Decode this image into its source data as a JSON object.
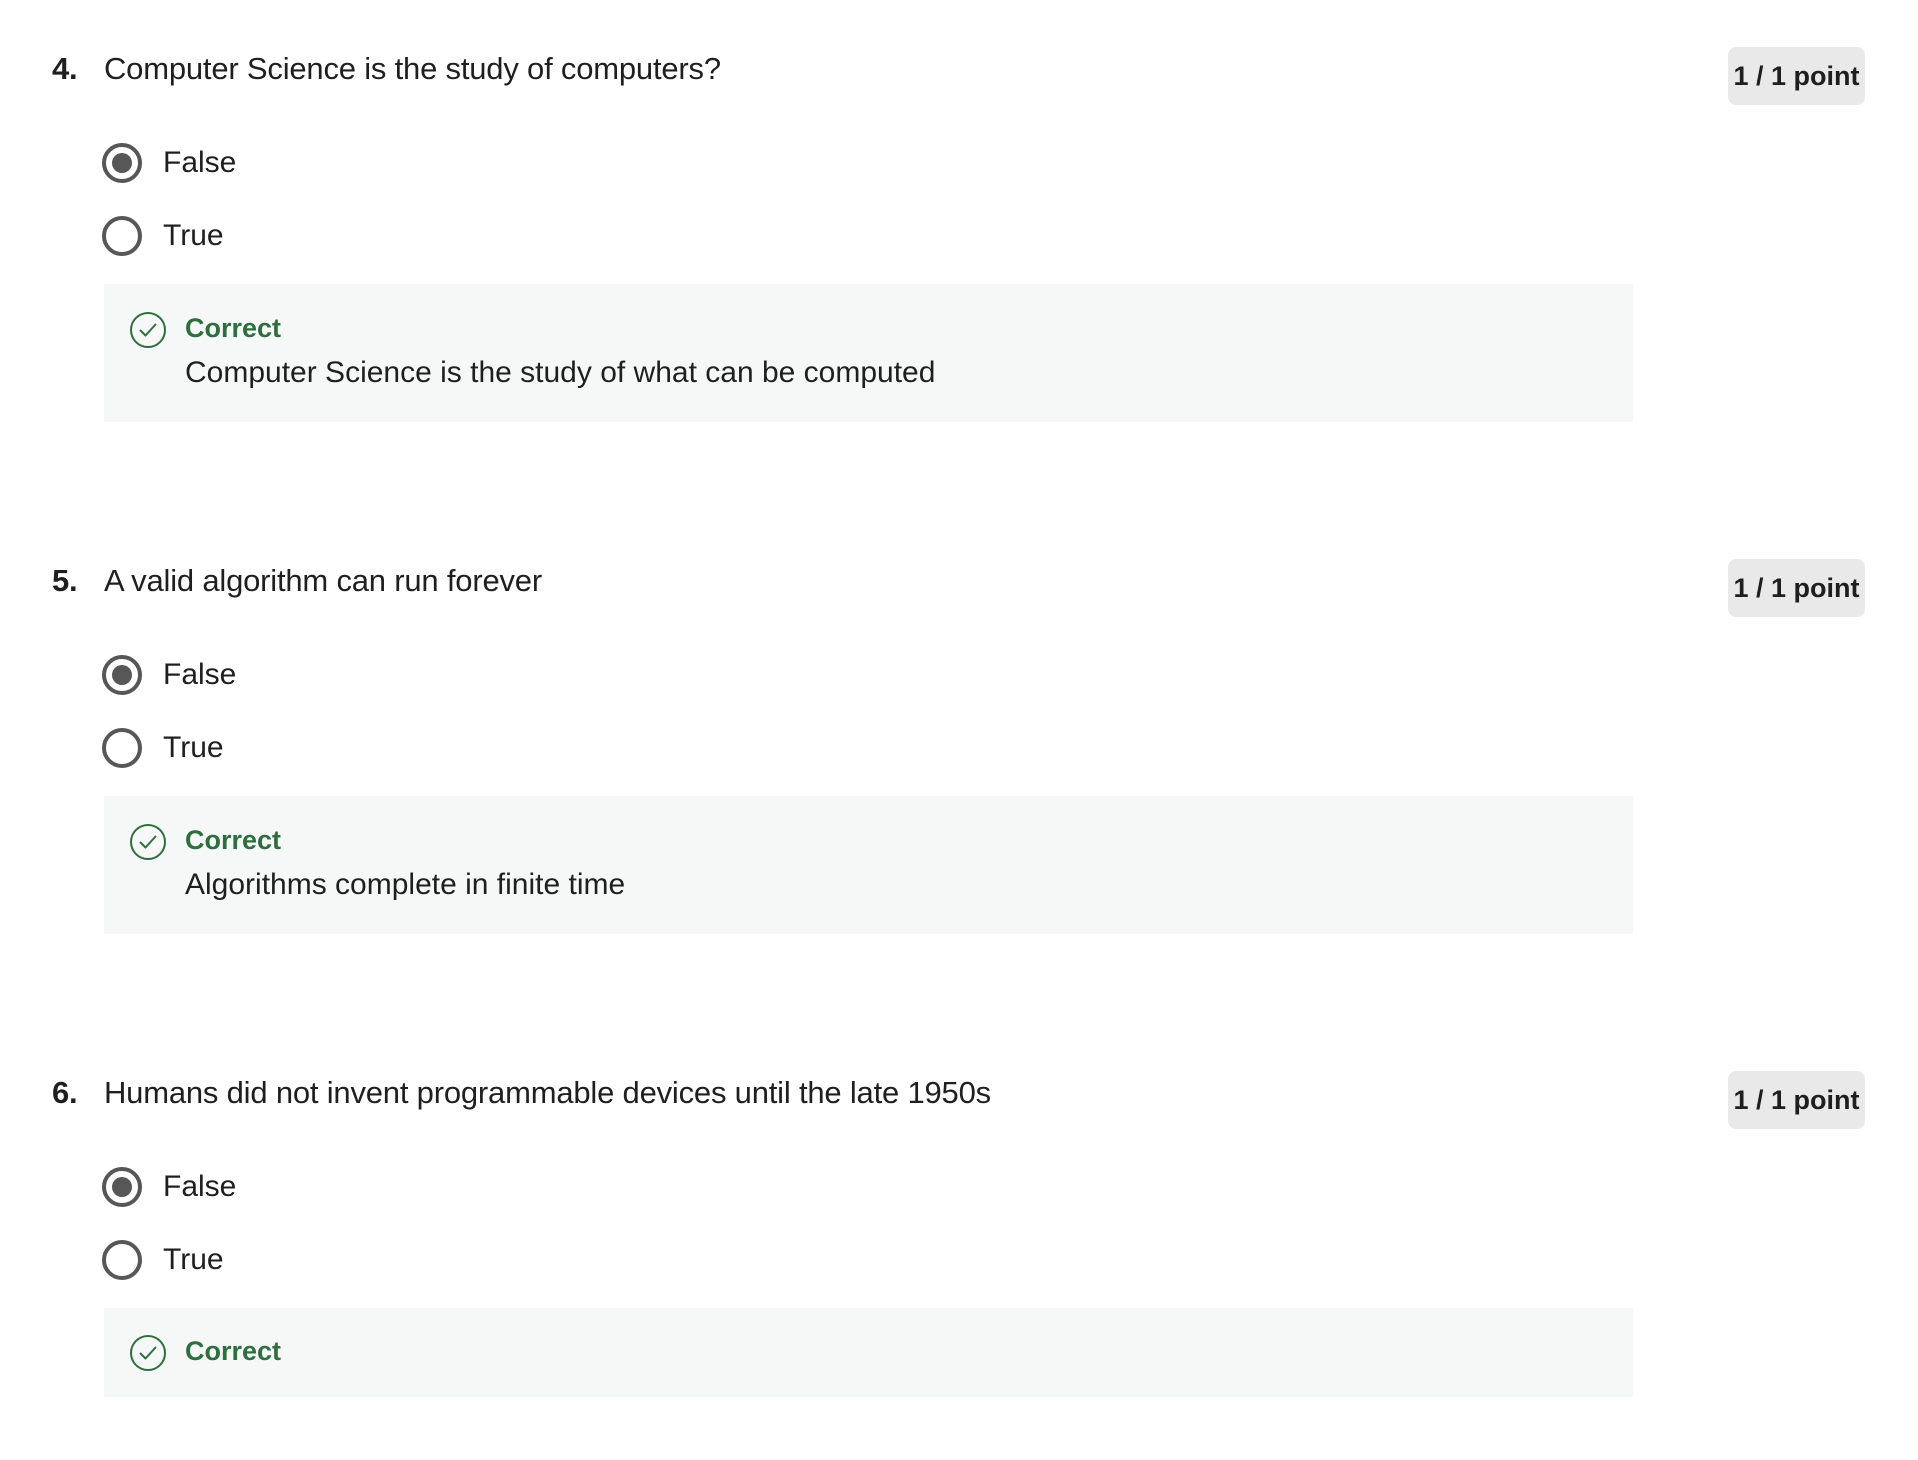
{
  "questions": [
    {
      "number": "4.",
      "text": "Computer Science is the study of computers?",
      "points": "1 / 1 point",
      "options": [
        {
          "label": "False",
          "selected": true
        },
        {
          "label": "True",
          "selected": false
        }
      ],
      "feedback": {
        "status": "Correct",
        "explanation": "Computer Science is the study of what can be computed",
        "icon": "check-circle-icon"
      }
    },
    {
      "number": "5.",
      "text": "A valid algorithm can run forever",
      "points": "1 / 1 point",
      "options": [
        {
          "label": "False",
          "selected": true
        },
        {
          "label": "True",
          "selected": false
        }
      ],
      "feedback": {
        "status": "Correct",
        "explanation": "Algorithms complete in finite time",
        "icon": "check-circle-icon"
      }
    },
    {
      "number": "6.",
      "text": "Humans did not invent programmable devices until the late 1950s",
      "points": "1 / 1 point",
      "options": [
        {
          "label": "False",
          "selected": true
        },
        {
          "label": "True",
          "selected": false
        }
      ],
      "feedback": {
        "status": "Correct",
        "explanation": "",
        "icon": "check-circle-icon"
      }
    }
  ],
  "colors": {
    "correct_green": "#2e6e3f",
    "feedback_bg": "#f6f8f7",
    "badge_bg": "#e9e9ea",
    "radio_gray": "#575757"
  }
}
